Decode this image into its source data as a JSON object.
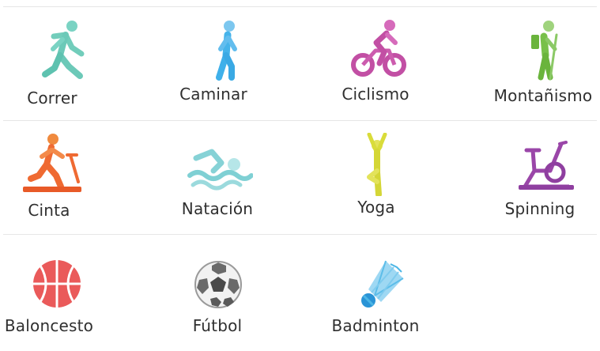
{
  "activities": [
    {
      "label": "Correr",
      "icon": "running-icon",
      "color": "#6cc9b8"
    },
    {
      "label": "Caminar",
      "icon": "walking-icon",
      "color": "#3fb0ea"
    },
    {
      "label": "Ciclismo",
      "icon": "cycling-icon",
      "color": "#c24fa4"
    },
    {
      "label": "Montañismo",
      "icon": "hiking-icon",
      "color": "#78c04a"
    },
    {
      "label": "Cinta",
      "icon": "treadmill-icon",
      "color": "#ef6a32"
    },
    {
      "label": "Natación",
      "icon": "swimming-icon",
      "color": "#7fd0d4"
    },
    {
      "label": "Yoga",
      "icon": "yoga-icon",
      "color": "#d9dc3a"
    },
    {
      "label": "Spinning",
      "icon": "spinning-bike-icon",
      "color": "#9a46a8"
    },
    {
      "label": "Baloncesto",
      "icon": "basketball-icon",
      "color": "#ea5a5a"
    },
    {
      "label": "Fútbol",
      "icon": "soccer-ball-icon",
      "color": "#777777"
    },
    {
      "label": "Badminton",
      "icon": "shuttlecock-icon",
      "color": "#4cb6e6"
    }
  ]
}
